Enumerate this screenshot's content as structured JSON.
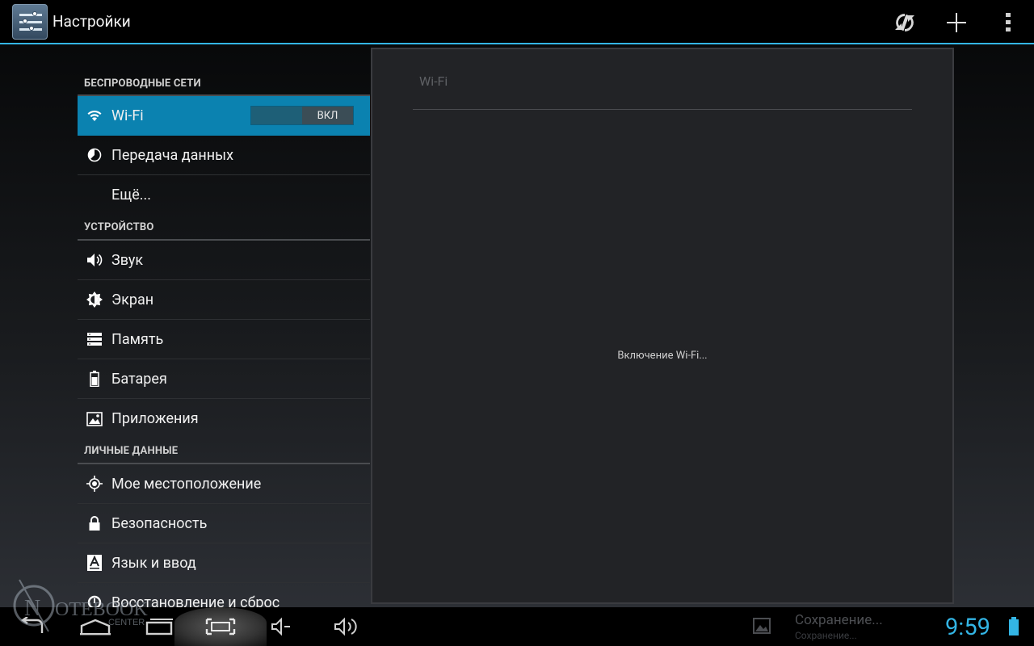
{
  "app": {
    "title": "Настройки"
  },
  "action_bar": {
    "icons": [
      "settings-app-icon",
      "sync-icon",
      "add-icon",
      "overflow-menu-icon"
    ]
  },
  "sections": [
    {
      "header": "БЕСПРОВОДНЫЕ СЕТИ",
      "items": [
        {
          "label": "Wi-Fi",
          "icon": "wifi-icon",
          "selected": true,
          "toggle": "ВКЛ"
        },
        {
          "label": "Передача данных",
          "icon": "data-usage-icon"
        },
        {
          "label": "Ещё..."
        }
      ]
    },
    {
      "header": "УСТРОЙСТВО",
      "items": [
        {
          "label": "Звук",
          "icon": "sound-icon"
        },
        {
          "label": "Экран",
          "icon": "display-icon"
        },
        {
          "label": "Память",
          "icon": "storage-icon"
        },
        {
          "label": "Батарея",
          "icon": "battery-icon"
        },
        {
          "label": "Приложения",
          "icon": "apps-icon"
        }
      ]
    },
    {
      "header": "ЛИЧНЫЕ ДАННЫЕ",
      "items": [
        {
          "label": "Мое местоположение",
          "icon": "location-icon"
        },
        {
          "label": "Безопасность",
          "icon": "lock-icon"
        },
        {
          "label": "Язык и ввод",
          "icon": "language-icon"
        },
        {
          "label": "Восстановление и сброс",
          "icon": "backup-icon"
        }
      ]
    }
  ],
  "detail": {
    "title": "Wi-Fi",
    "status": "Включение Wi-Fi..."
  },
  "system_bar": {
    "notification_title": "Сохранение...",
    "notification_sub": "Сохранение...",
    "clock": "9:59",
    "watermark": "NOTEBOOK CENTER"
  },
  "colors": {
    "accent": "#33b5e5",
    "selected": "#0b82b0"
  }
}
